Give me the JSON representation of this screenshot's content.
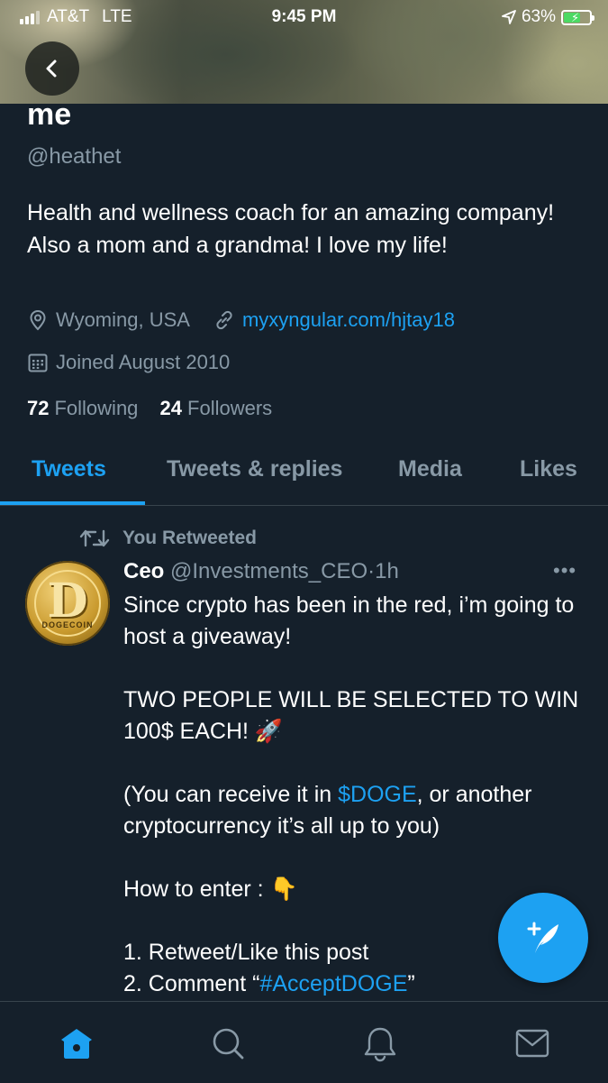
{
  "status_bar": {
    "carrier": "AT&T",
    "network": "LTE",
    "time": "9:45 PM",
    "battery": "63%",
    "battery_level": 0.63
  },
  "profile": {
    "name": "me",
    "handle": "@heathet",
    "bio": "Health and wellness coach for an amazing company! Also a mom and a grandma! I love my life!",
    "location": "Wyoming, USA",
    "website": "myxyngular.com/hjtay18",
    "joined": "Joined August 2010",
    "following_count": "72",
    "following_label": "Following",
    "followers_count": "24",
    "followers_label": "Followers"
  },
  "tabs": [
    {
      "label": "Tweets",
      "active": true
    },
    {
      "label": "Tweets & replies",
      "active": false
    },
    {
      "label": "Media",
      "active": false
    },
    {
      "label": "Likes",
      "active": false
    }
  ],
  "tweet": {
    "retweet_label": "You Retweeted",
    "author_name": "Ceo",
    "author_handle": "@Investments_CEO",
    "separator": "·",
    "time": "1h",
    "avatar_text": "DOGECOIN",
    "avatar_letter": "D",
    "more": "•••",
    "line1": "Since crypto has been in the red, i’m going to host a giveaway!",
    "line2": "TWO PEOPLE WILL BE SELECTED TO WIN 100$ EACH! 🚀",
    "line3_pre": "(You can receive it in ",
    "line3_tag": "$DOGE",
    "line3_post": ", or another cryptocurrency it’s all up to you)",
    "line4": "How to enter : 👇",
    "step1": "1. Retweet/Like this post",
    "step2_pre": "2. Comment “",
    "step2_tag": "#AcceptDOGE",
    "step2_post": "”"
  },
  "colors": {
    "background": "#15202b",
    "accent": "#1da1f2",
    "secondary_text": "#8899a6",
    "divider": "#38444d"
  },
  "icons": {
    "back": "chevron-left-icon",
    "location": "location-pin-icon",
    "link": "link-icon",
    "calendar": "calendar-icon",
    "retweet": "retweet-icon",
    "compose": "compose-tweet-icon",
    "home": "home-icon",
    "search": "search-icon",
    "notifications": "bell-icon",
    "messages": "mail-icon"
  }
}
